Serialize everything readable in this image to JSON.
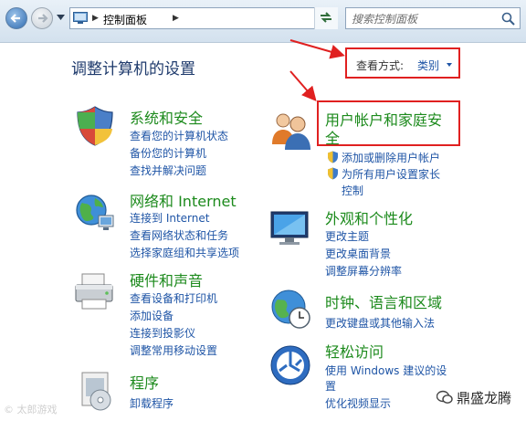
{
  "address_bar": {
    "path": "控制面板"
  },
  "search": {
    "placeholder": "搜索控制面板"
  },
  "header": {
    "title": "调整计算机的设置",
    "view_label": "查看方式:",
    "view_value": "类别"
  },
  "categories": {
    "system_security": {
      "title": "系统和安全",
      "links": [
        "查看您的计算机状态",
        "备份您的计算机",
        "查找并解决问题"
      ]
    },
    "network": {
      "title": "网络和 Internet",
      "links": [
        "连接到 Internet",
        "查看网络状态和任务",
        "选择家庭组和共享选项"
      ]
    },
    "hardware": {
      "title": "硬件和声音",
      "links": [
        "查看设备和打印机",
        "添加设备",
        "连接到投影仪",
        "调整常用移动设置"
      ]
    },
    "programs": {
      "title": "程序",
      "links": [
        "卸载程序"
      ]
    },
    "user_accounts": {
      "title_line1": "用户帐户和家庭安",
      "title_line2": "全",
      "links": [
        "添加或删除用户帐户",
        "为所有用户设置家长",
        "控制"
      ]
    },
    "appearance": {
      "title": "外观和个性化",
      "links": [
        "更改主题",
        "更改桌面背景",
        "调整屏幕分辨率"
      ]
    },
    "clock": {
      "title": "时钟、语言和区域",
      "links": [
        "更改键盘或其他输入法"
      ]
    },
    "ease": {
      "title": "轻松访问",
      "links": [
        "使用 Windows 建议的设",
        "置",
        "优化视频显示"
      ]
    }
  },
  "watermarks": {
    "left": "© 太郎游戏",
    "right": "鼎盛龙腾"
  },
  "colors": {
    "link": "#1f55a6",
    "category_title": "#1c8a1c",
    "annotation": "#e02020"
  }
}
